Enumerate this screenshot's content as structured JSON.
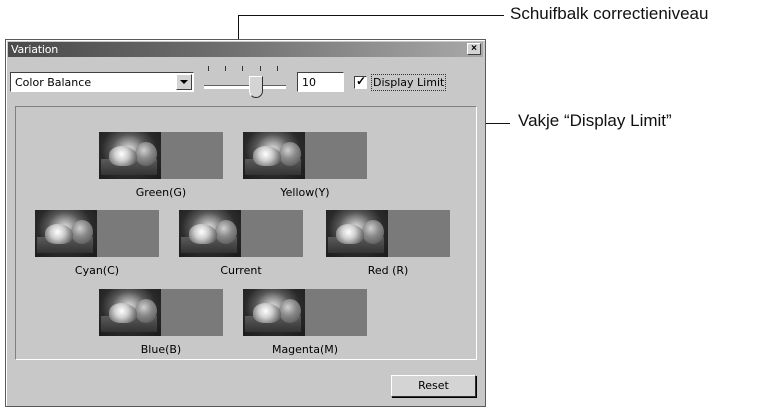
{
  "callouts": {
    "slider": "Schuifbalk correctieniveau",
    "checkbox": "Vakje “Display Limit”"
  },
  "window": {
    "title": "Variation",
    "close_glyph": "×"
  },
  "controls": {
    "mode_select": "Color Balance",
    "slider_level": 10,
    "level_value": "10",
    "display_limit_label": "Display Limit",
    "display_limit_checked": true
  },
  "variations": [
    {
      "label": "Green(G)"
    },
    {
      "label": "Yellow(Y)"
    },
    {
      "label": "Cyan(C)"
    },
    {
      "label": "Current"
    },
    {
      "label": "Red (R)"
    },
    {
      "label": "Blue(B)"
    },
    {
      "label": "Magenta(M)"
    }
  ],
  "reset_label": "Reset"
}
